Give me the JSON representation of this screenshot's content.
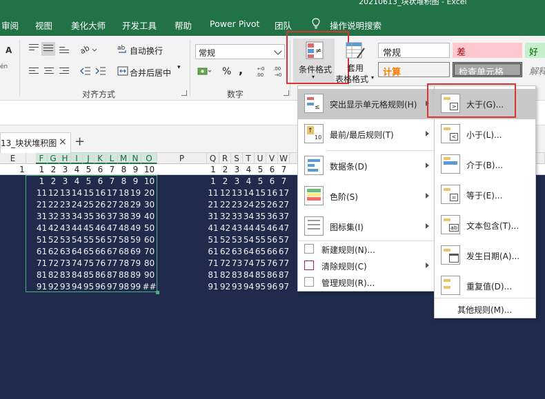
{
  "window": {
    "title": "20210613_块状堆积图 - Excel"
  },
  "tabs": [
    "审阅",
    "视图",
    "美化大师",
    "开发工具",
    "帮助",
    "Power Pivot",
    "团队",
    "操作说明搜索"
  ],
  "ribbon": {
    "wrap_text": "自动换行",
    "merge_center": "合并后居中",
    "align_group": "对齐方式",
    "number_format": "常规",
    "number_group": "数字",
    "percent": "%",
    "comma": ",",
    "conditional_format": "条件格式",
    "table_format_1": "套用",
    "table_format_2": "表格格式",
    "styles": [
      {
        "label": "常规",
        "bg": "#ffffff",
        "color": "#000000"
      },
      {
        "label": "差",
        "bg": "#ffc7ce",
        "color": "#9c0006"
      },
      {
        "label": "好",
        "bg": "#c6efce",
        "color": "#006100"
      },
      {
        "label": "计算",
        "bg": "#f2f2f2",
        "color": "#fa7d00"
      },
      {
        "label": "检查单元格",
        "bg": "#a5a5a5",
        "color": "#ffffff"
      },
      {
        "label": "解释",
        "bg": "#ffffff",
        "color": "#7f7f7f"
      }
    ],
    "left_cut_a": "A",
    "left_cut_en": "én"
  },
  "sheet": {
    "tab_name": "13_块状堆积图",
    "close": "×",
    "add": "+",
    "columns_left": [
      "E",
      "F",
      "G",
      "H",
      "I",
      "J",
      "K",
      "L",
      "M",
      "N",
      "O"
    ],
    "columns_mid": [
      "P"
    ],
    "columns_right": [
      "Q",
      "R",
      "S",
      "T",
      "U",
      "V",
      "W"
    ],
    "column_far": "A",
    "row1_num": "1",
    "row1_left": [
      "1",
      "2",
      "3",
      "4",
      "5",
      "6",
      "7",
      "8",
      "9",
      "10"
    ],
    "row1_right": [
      "1",
      "2",
      "3",
      "4",
      "5",
      "6",
      "7"
    ],
    "grid_left": [
      [
        "1",
        "2",
        "3",
        "4",
        "5",
        "6",
        "7",
        "8",
        "9",
        "10"
      ],
      [
        "11",
        "12",
        "13",
        "14",
        "15",
        "16",
        "17",
        "18",
        "19",
        "20"
      ],
      [
        "21",
        "22",
        "23",
        "24",
        "25",
        "26",
        "27",
        "28",
        "29",
        "30"
      ],
      [
        "31",
        "32",
        "33",
        "34",
        "35",
        "36",
        "37",
        "38",
        "39",
        "40"
      ],
      [
        "41",
        "42",
        "43",
        "44",
        "45",
        "46",
        "47",
        "48",
        "49",
        "50"
      ],
      [
        "51",
        "52",
        "53",
        "54",
        "55",
        "56",
        "57",
        "58",
        "59",
        "60"
      ],
      [
        "61",
        "62",
        "63",
        "64",
        "65",
        "66",
        "67",
        "68",
        "69",
        "70"
      ],
      [
        "71",
        "72",
        "73",
        "74",
        "75",
        "76",
        "77",
        "78",
        "79",
        "80"
      ],
      [
        "81",
        "82",
        "83",
        "84",
        "85",
        "86",
        "87",
        "88",
        "89",
        "90"
      ],
      [
        "91",
        "92",
        "93",
        "94",
        "95",
        "96",
        "97",
        "98",
        "99",
        "##"
      ]
    ],
    "grid_right": [
      [
        "1",
        "2",
        "3",
        "4",
        "5",
        "6",
        "7"
      ],
      [
        "11",
        "12",
        "13",
        "14",
        "15",
        "16",
        "17"
      ],
      [
        "21",
        "22",
        "23",
        "24",
        "25",
        "26",
        "27"
      ],
      [
        "31",
        "32",
        "33",
        "34",
        "35",
        "36",
        "37"
      ],
      [
        "41",
        "42",
        "43",
        "44",
        "45",
        "46",
        "47"
      ],
      [
        "51",
        "52",
        "53",
        "54",
        "55",
        "56",
        "57"
      ],
      [
        "61",
        "62",
        "63",
        "64",
        "65",
        "66",
        "67"
      ],
      [
        "71",
        "72",
        "73",
        "74",
        "75",
        "76",
        "77"
      ],
      [
        "81",
        "82",
        "83",
        "84",
        "85",
        "86",
        "87"
      ],
      [
        "91",
        "92",
        "93",
        "94",
        "95",
        "96",
        "97"
      ]
    ]
  },
  "menu": {
    "items": [
      {
        "label": "突出显示单元格规则(H)",
        "icon": "highlight-rules-icon",
        "submenu": true,
        "active": true
      },
      {
        "label": "最前/最后规则(T)",
        "icon": "top-bottom-icon",
        "submenu": true
      },
      {
        "label": "数据条(D)",
        "icon": "data-bar-icon",
        "submenu": true
      },
      {
        "label": "色阶(S)",
        "icon": "color-scale-icon",
        "submenu": true
      },
      {
        "label": "图标集(I)",
        "icon": "icon-set-icon",
        "submenu": true
      }
    ],
    "small_items": [
      {
        "label": "新建规则(N)...",
        "submenu": false
      },
      {
        "label": "清除规则(C)",
        "submenu": true
      },
      {
        "label": "管理规则(R)...",
        "submenu": false
      }
    ]
  },
  "submenu": {
    "items": [
      {
        "label": "大于(G)...",
        "active": true
      },
      {
        "label": "小于(L)..."
      },
      {
        "label": "介于(B)..."
      },
      {
        "label": "等于(E)..."
      },
      {
        "label": "文本包含(T)..."
      },
      {
        "label": "发生日期(A)..."
      },
      {
        "label": "重复值(D)..."
      }
    ],
    "more": "其他规则(M)..."
  },
  "colors": {
    "excel_green": "#217346",
    "grid_bg": "#1f2a4d",
    "highlight_red": "#e03131"
  }
}
